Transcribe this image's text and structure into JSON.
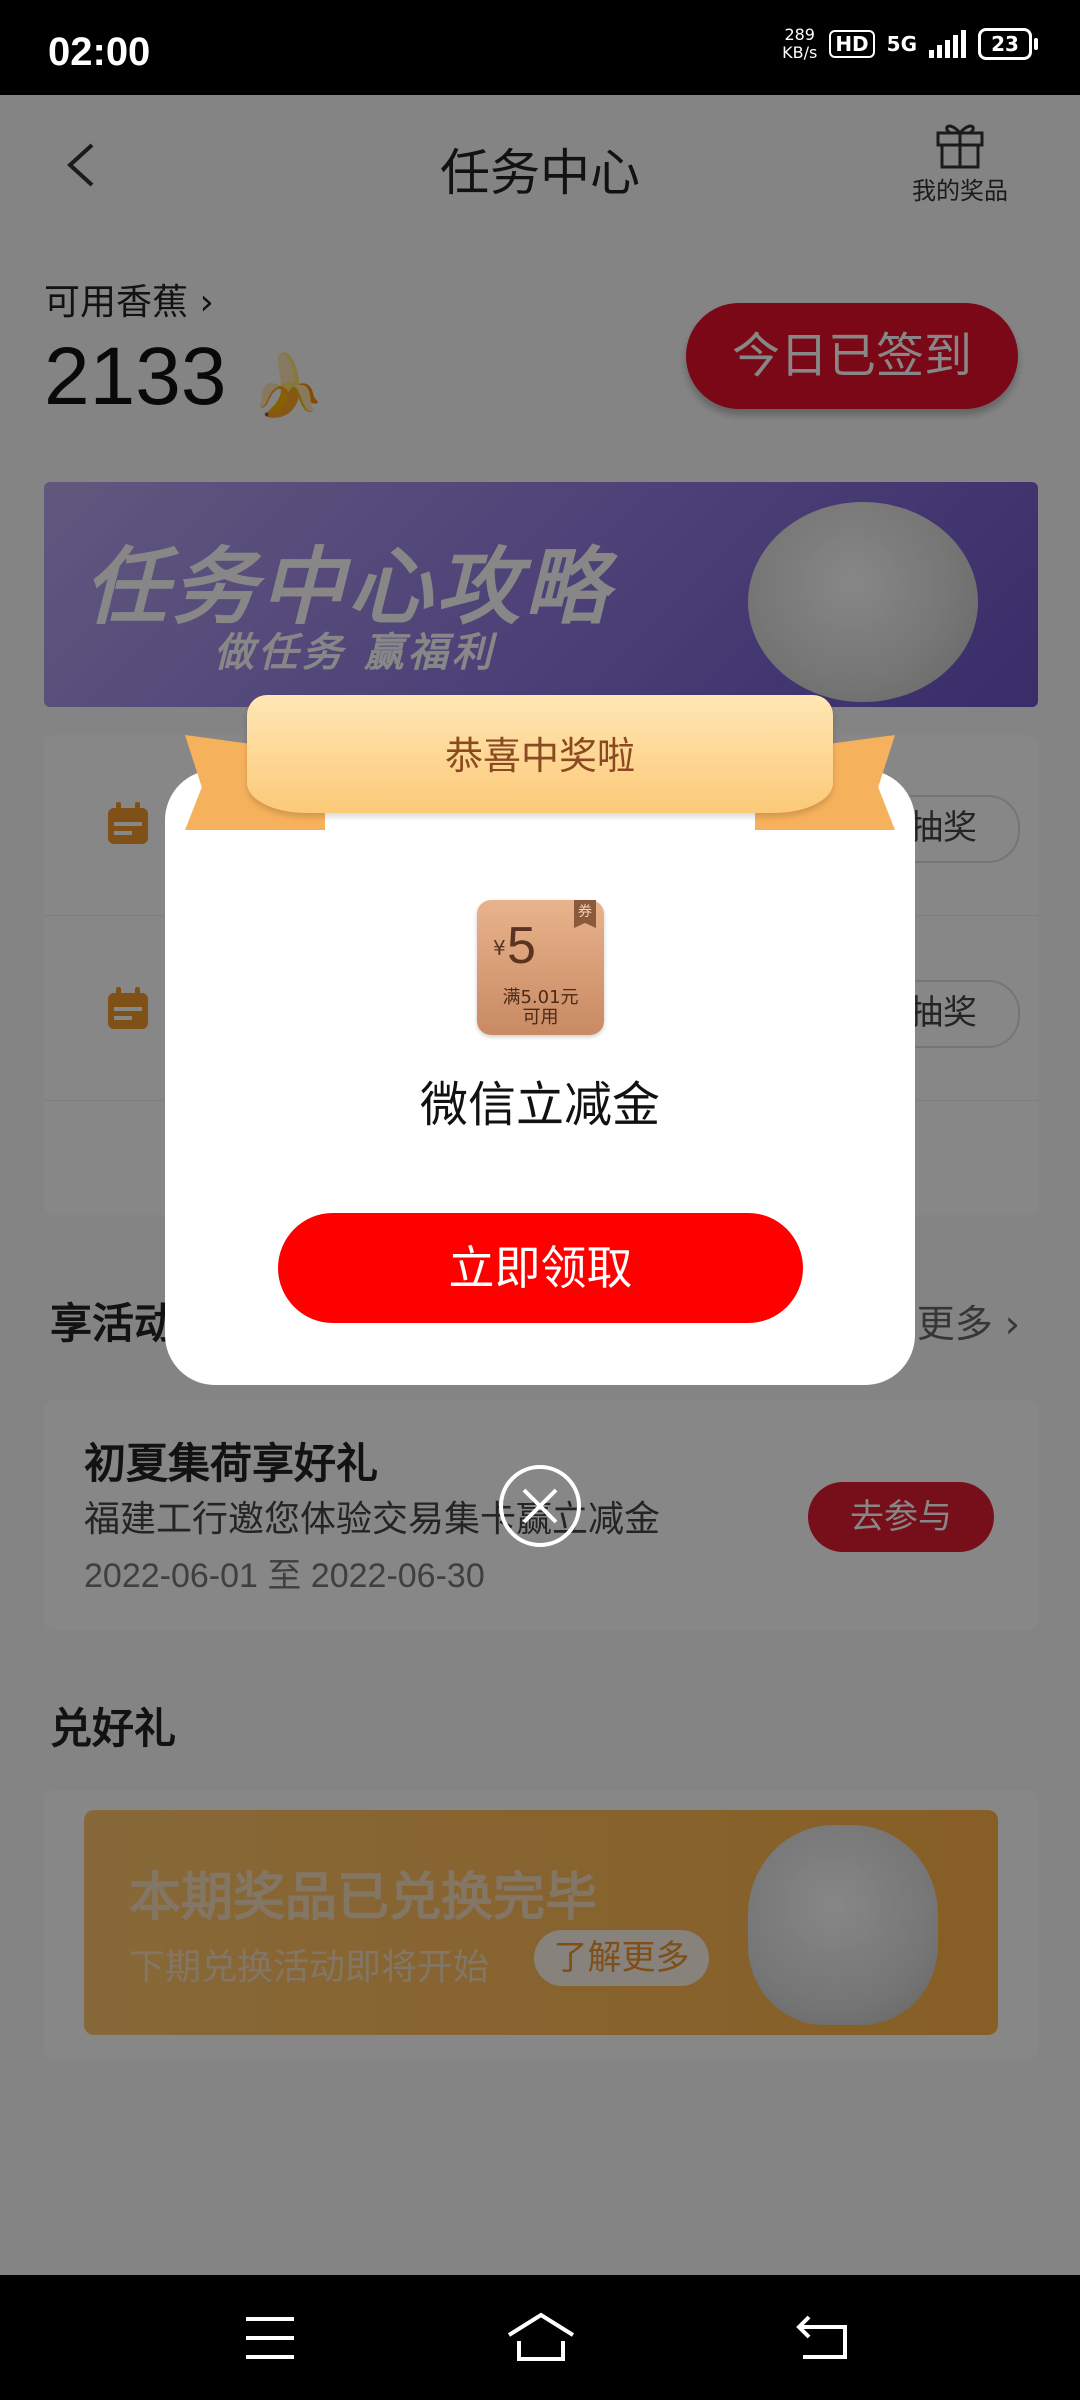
{
  "status_bar": {
    "time": "02:00",
    "speed_value": "289",
    "speed_unit": "KB/s",
    "hd": "HD",
    "network": "5G",
    "battery": "23"
  },
  "header": {
    "title": "任务中心",
    "prizes_label": "我的奖品"
  },
  "bananas": {
    "label": "可用香蕉",
    "count": "2133",
    "signin_button": "今日已签到"
  },
  "banner": {
    "title": "任务中心攻略",
    "subtitle": "做任务 赢福利"
  },
  "tasks": [
    {
      "button": "抽奖"
    },
    {
      "button": "抽奖"
    }
  ],
  "activities": {
    "section_title": "享活动",
    "more": "更多",
    "item": {
      "title": "初夏集荷享好礼",
      "desc": "福建工行邀您体验交易集卡赢立减金",
      "date": "2022-06-01 至 2022-06-30",
      "button": "去参与"
    }
  },
  "redeem": {
    "section_title": "兑好礼",
    "title": "本期奖品已兑换完毕",
    "subtitle": "下期兑换活动即将开始",
    "button": "了解更多"
  },
  "modal": {
    "ribbon": "恭喜中奖啦",
    "coupon": {
      "symbol": "¥",
      "value": "5",
      "condition_line1": "满5.01元",
      "condition_line2": "可用",
      "tag": "券"
    },
    "prize_name": "微信立减金",
    "claim_button": "立即领取"
  },
  "colors": {
    "accent_red": "#ff0000",
    "brand_red": "#e9102a",
    "ribbon_gold": "#fcc978"
  }
}
